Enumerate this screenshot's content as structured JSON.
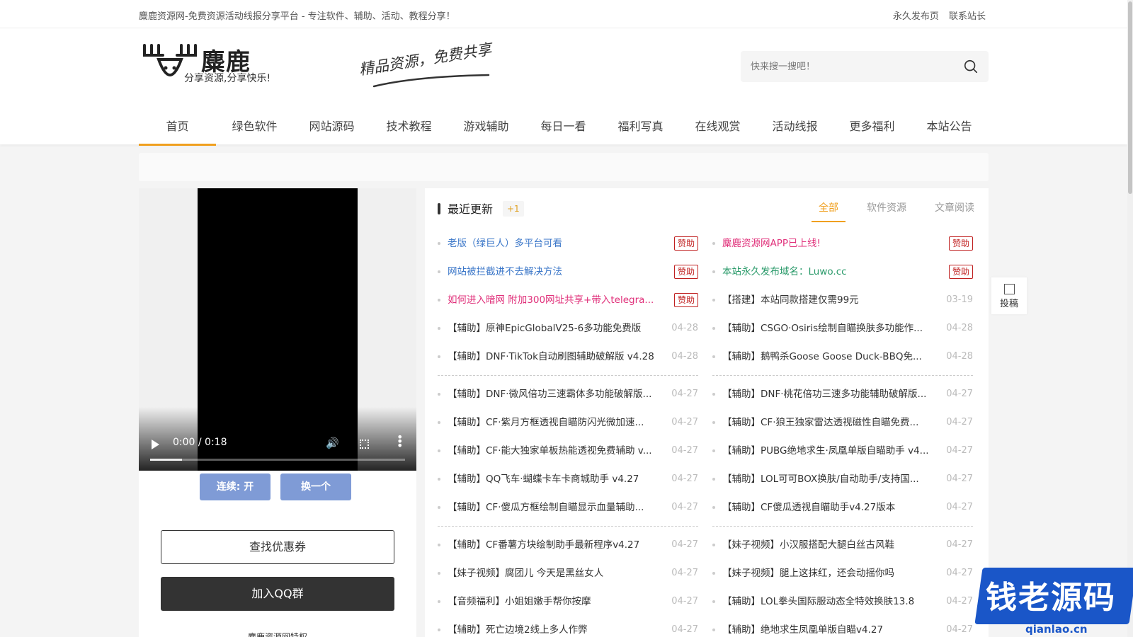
{
  "topbar": {
    "slogan": "麋鹿资源网-免费资源活动线报分享平台 - 专注软件、辅助、活动、教程分享！",
    "links": [
      "永久发布页",
      "联系站长"
    ]
  },
  "logo": {
    "name": "麋鹿",
    "tagline": "分享资源,分享快乐!"
  },
  "brush_slogan": "精品资源，免费共享",
  "search": {
    "placeholder": "快来搜一搜吧！"
  },
  "nav": [
    "首页",
    "绿色软件",
    "网站源码",
    "技术教程",
    "游戏辅助",
    "每日一看",
    "福利写真",
    "在线观赏",
    "活动线报",
    "更多福利",
    "本站公告"
  ],
  "video": {
    "time": "0:00 / 0:18",
    "progress": 0.125,
    "btn_continuous": "连续: 开",
    "btn_switch": "换一个"
  },
  "sidebar": {
    "coupon": "查找优惠券",
    "qq": "加入QQ群",
    "special": "麋鹿资源网特权"
  },
  "updates": {
    "title": "最近更新",
    "badge": "+1",
    "tabs": [
      "全部",
      "软件资源",
      "文章阅读"
    ],
    "sponsor": "赞助",
    "col1": [
      {
        "t": "老版（绿巨人）多平台可看",
        "z": "赞助",
        "style": "blue"
      },
      {
        "t": "网站被拦截进不去解决方法",
        "z": "赞助",
        "style": "blue"
      },
      {
        "t": "如何进入暗网 附加300网址共享+带入telegra...",
        "z": "赞助",
        "style": "pink"
      },
      {
        "t": "【辅助】原神EpicGlobalV25-6多功能免费版",
        "d": "04-28"
      },
      {
        "t": "【辅助】DNF·TikTok自动刷图辅助破解版 v4.28",
        "d": "04-28"
      },
      {
        "sep": true
      },
      {
        "t": "【辅助】DNF·微风倍功三速霸体多功能破解版...",
        "d": "04-27"
      },
      {
        "t": "【辅助】CF·紫月方框透视自瞄防闪光微加速...",
        "d": "04-27"
      },
      {
        "t": "【辅助】CF·能大独家单板热能透视免费辅助 v...",
        "d": "04-27"
      },
      {
        "t": "【辅助】QQ飞车·蝴蝶卡车卡商城助手 v4.27",
        "d": "04-27"
      },
      {
        "t": "【辅助】CF·傻瓜方框绘制自瞄显示血量辅助...",
        "d": "04-27"
      },
      {
        "sep": true
      },
      {
        "t": "【辅助】CF番薯方块绘制助手最新程序v4.27",
        "d": "04-27"
      },
      {
        "t": "【妹子视频】腐团儿 今天是黑丝女人",
        "d": "04-27"
      },
      {
        "t": "【音频福利】小姐姐嫩手帮你按摩",
        "d": "04-27"
      },
      {
        "t": "【辅助】死亡边境2线上多人作弊",
        "d": "04-27"
      }
    ],
    "col2": [
      {
        "t": "麋鹿资源网APP已上线!",
        "z": "赞助",
        "style": "pink"
      },
      {
        "t": "本站永久发布域名：Luwo.cc",
        "z": "赞助",
        "style": "green"
      },
      {
        "t": "【搭建】本站同款搭建仅需99元",
        "d": "03-19"
      },
      {
        "t": "【辅助】CSGO·Osiris绘制自瞄换肤多功能作...",
        "d": "04-28"
      },
      {
        "t": "【辅助】鹅鸭杀Goose Goose Duck-BBQ免...",
        "d": "04-28"
      },
      {
        "sep": true
      },
      {
        "t": "【辅助】DNF·桃花倍功三速多功能辅助破解版...",
        "d": "04-27"
      },
      {
        "t": "【辅助】CF·狼王独家雷达透视磁性自瞄免费...",
        "d": "04-27"
      },
      {
        "t": "【辅助】PUBG绝地求生·凤凰单版自瞄助手 v4...",
        "d": "04-27"
      },
      {
        "t": "【辅助】LOL可可BOX换肤/自动助手/支持国...",
        "d": "04-27"
      },
      {
        "t": "【辅助】CF傻瓜透视自瞄助手v4.27版本",
        "d": "04-27"
      },
      {
        "sep": true
      },
      {
        "t": "【妹子视频】小汉服搭配大腿白丝古风鞋",
        "d": "04-27"
      },
      {
        "t": "【妹子视频】腿上这抹红，还会动摇你吗",
        "d": "04-27"
      },
      {
        "t": "【辅助】LOL拳头国际服动态全特效换肤13.8",
        "d": "04-27"
      },
      {
        "t": "【辅助】绝地求生凤凰单版自瞄v4.27",
        "d": "04-27"
      }
    ]
  },
  "contribute": "投稿",
  "watermark": {
    "text": "钱老源码",
    "url": "qianlao.cn"
  },
  "colors": {
    "accent": "#f0a020",
    "sponsor": "#c02020",
    "link_blue": "#3a76c8",
    "link_pink": "#e0307a",
    "link_green": "#2a9a6a",
    "video_btn": "#7f9bd6"
  }
}
